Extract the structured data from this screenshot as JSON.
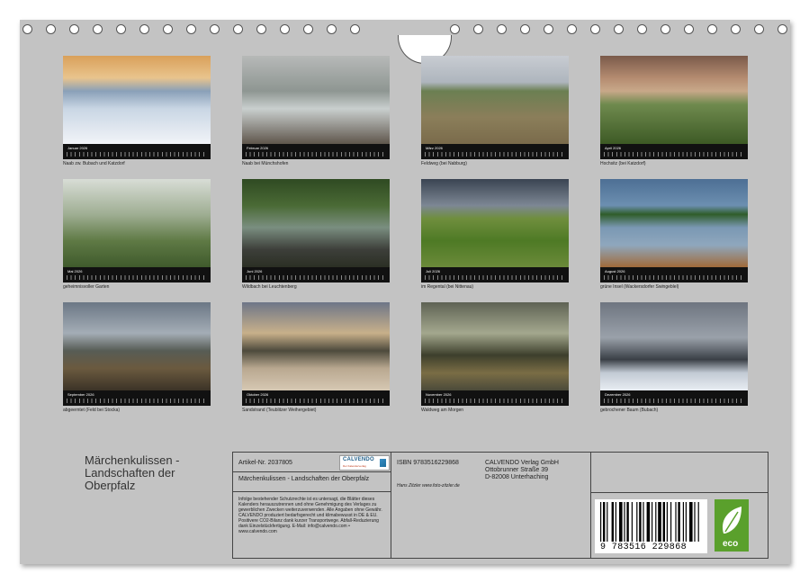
{
  "months": [
    {
      "name": "Januar 2026",
      "caption": "Naab zw. Bubach und Katzdorf",
      "scene": "winter-river"
    },
    {
      "name": "Februar 2026",
      "caption": "Naab bei Münchshofen",
      "scene": "willow-river"
    },
    {
      "name": "März 2026",
      "caption": "Feldweg (bei Nabburg)",
      "scene": "field-path"
    },
    {
      "name": "April 2026",
      "caption": "Hochsitz (bei Katzdorf)",
      "scene": "hunting-stand"
    },
    {
      "name": "Mai 2026",
      "caption": "geheimnisvoller Garten",
      "scene": "misty-garden"
    },
    {
      "name": "Juni 2026",
      "caption": "Wildbach bei Leuchtenberg",
      "scene": "forest-stream"
    },
    {
      "name": "Juli 2026",
      "caption": "im Regental (bei Nittenau)",
      "scene": "green-path"
    },
    {
      "name": "August 2026",
      "caption": "grüne Insel (Wackersdorfer Swingeblel)",
      "scene": "lake-island"
    },
    {
      "name": "September 2026",
      "caption": "abgeerntet (Feld bei Stocka)",
      "scene": "harvested-field"
    },
    {
      "name": "Oktober 2026",
      "caption": "Sandstrand (Teublitzer Weihergebiet)",
      "scene": "sand-beach"
    },
    {
      "name": "November 2026",
      "caption": "Waldweg am Morgen",
      "scene": "forest-light"
    },
    {
      "name": "Dezember 2026",
      "caption": "gebrochener Baum (Bubach)",
      "scene": "broken-tree"
    }
  ],
  "title": "Märchenkulissen - Landschaften der Oberpfalz",
  "info": {
    "article": "Artikel-Nr. 2037805",
    "logo": "CALVENDO",
    "logo_sub": "Der Kalenderverlag",
    "subtitle": "Märchenkulissen - Landschaften der Oberpfalz",
    "legal": "Infolge bestehender Schutzrechte ist es untersagt, die Blätter dieses Kalenders herauszutrennen und ohne Genehmigung des Verlages zu gewerblichen Zwecken weiterzuverwenden. Alle Angaben ohne Gewähr. CALVENDO produziert bedarfsgerecht und klimabewusst in DE & EU. Positivere CO2-Bilanz dank kurzer Transportwege. Abfall-Reduzierung dank Einzelstückfertigung. E-Mail: info@calvendo.com • www.calvendo.com",
    "isbn": "ISBN 9783516229868",
    "author": "Hans Zitzler www.foto-zitzler.de",
    "publisher": [
      "CALVENDO Verlag GmbH",
      "Ottobrunner Straße 39",
      "D-82008 Unterhaching"
    ],
    "barcode_digits": "9 783516 229868",
    "eco": "eco"
  }
}
